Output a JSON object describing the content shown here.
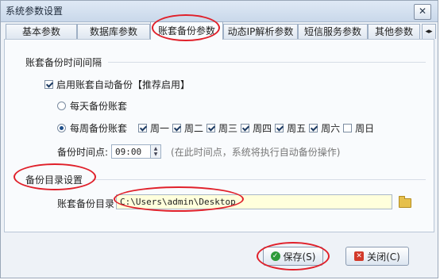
{
  "window": {
    "title": "系统参数设置"
  },
  "tabs": [
    {
      "label": "基本参数"
    },
    {
      "label": "数据库参数"
    },
    {
      "label": "账套备份参数"
    },
    {
      "label": "动态IP解析参数"
    },
    {
      "label": "短信服务参数"
    },
    {
      "label": "其他参数"
    }
  ],
  "backup_interval": {
    "section_title": "账套备份时间间隔",
    "auto_backup": {
      "label": "启用账套自动备份【推荐启用】",
      "checked": true
    },
    "daily": {
      "label": "每天备份账套",
      "selected": false
    },
    "weekly": {
      "label": "每周备份账套",
      "selected": true
    },
    "days": [
      {
        "label": "周一",
        "checked": true
      },
      {
        "label": "周二",
        "checked": true
      },
      {
        "label": "周三",
        "checked": true
      },
      {
        "label": "周四",
        "checked": true
      },
      {
        "label": "周五",
        "checked": true
      },
      {
        "label": "周六",
        "checked": true
      },
      {
        "label": "周日",
        "checked": false
      }
    ],
    "time_label": "备份时间点:",
    "time_value": "09:00",
    "time_hint": "(在此时间点，系统将执行自动备份操作)"
  },
  "backup_dir": {
    "section_title": "备份目录设置",
    "label": "账套备份目录",
    "path": "C:\\Users\\admin\\Desktop"
  },
  "buttons": {
    "save": "保存(S)",
    "close": "关闭(C)"
  },
  "colors": {
    "highlight": "#e0202a",
    "path_bg": "#ffffdc"
  }
}
